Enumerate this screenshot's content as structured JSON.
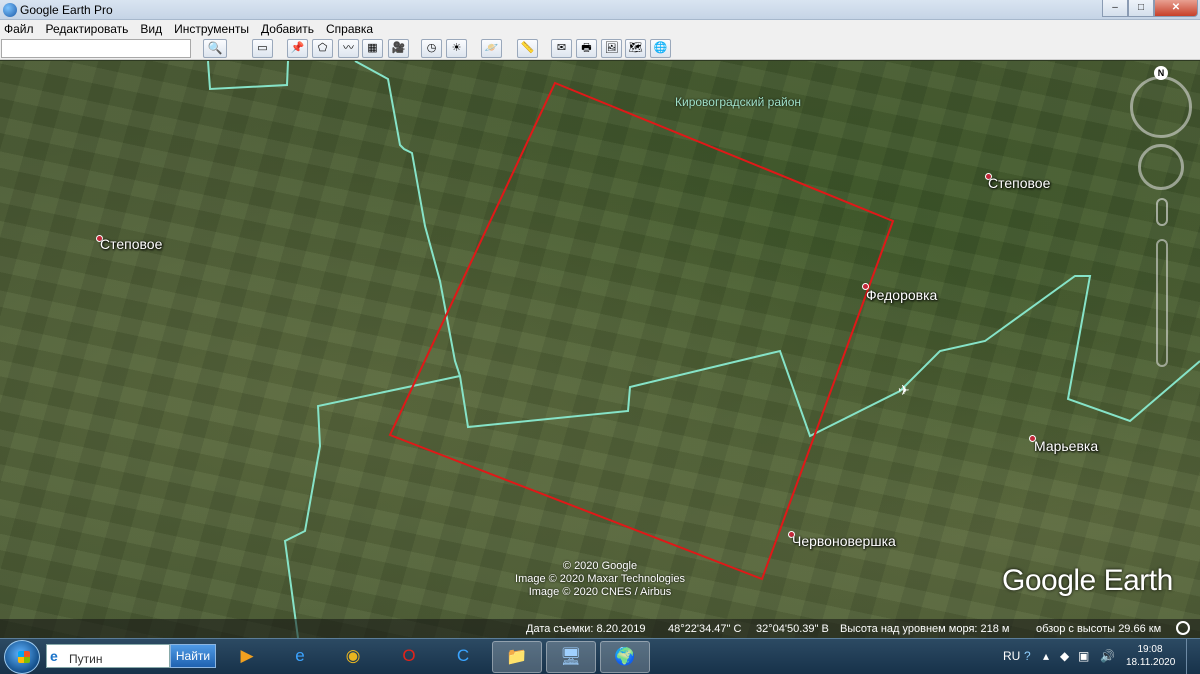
{
  "window": {
    "title": "Google Earth Pro",
    "controls": {
      "minimize": "–",
      "maximize": "□",
      "close": "✕"
    }
  },
  "menu": [
    "Файл",
    "Редактировать",
    "Вид",
    "Инструменты",
    "Добавить",
    "Справка"
  ],
  "search": {
    "value": "",
    "button_icon": "search-icon"
  },
  "toolbar": {
    "buttons": [
      {
        "name": "sidebar-icon",
        "glyph": "▭"
      },
      {
        "name": "add-placemark-icon",
        "glyph": "📌"
      },
      {
        "name": "add-polygon-icon",
        "glyph": "⬠"
      },
      {
        "name": "add-path-icon",
        "glyph": "〰"
      },
      {
        "name": "add-overlay-icon",
        "glyph": "▦"
      },
      {
        "name": "record-tour-icon",
        "glyph": "🎥"
      },
      {
        "name": "historical-imagery-icon",
        "glyph": "◷"
      },
      {
        "name": "sunlight-icon",
        "glyph": "☀"
      },
      {
        "name": "planets-icon",
        "glyph": "🪐"
      },
      {
        "name": "ruler-icon",
        "glyph": "📏"
      },
      {
        "name": "email-icon",
        "glyph": "✉"
      },
      {
        "name": "print-icon",
        "glyph": "🖶"
      },
      {
        "name": "save-image-icon",
        "glyph": "🖼"
      },
      {
        "name": "view-in-maps-icon",
        "glyph": "🗺"
      },
      {
        "name": "earth-icon",
        "glyph": "🌐"
      }
    ]
  },
  "map": {
    "region_label": "Кировоградский район",
    "places": [
      {
        "name": "Степовое"
      },
      {
        "name": "Степовое"
      },
      {
        "name": "Федоровка"
      },
      {
        "name": "Марьевка"
      },
      {
        "name": "Червоновершка"
      }
    ],
    "credits": [
      "© 2020 Google",
      "Image © 2020 Maxar Technologies",
      "Image © 2020 CNES / Airbus"
    ],
    "logo": "Google Earth",
    "compass_north": "N",
    "colors": {
      "polygon": "#e01818",
      "border": "#86e3c8",
      "place_dot": "#c3283a"
    }
  },
  "status": {
    "date": "Дата съемки: 8.20.2019",
    "lat": "48°22'34.47\" С",
    "lon": "32°04'50.39\" В",
    "elevation": "Высота над уровнем моря:  218 м",
    "eye_alt": "обзор с высоты  29.66 км"
  },
  "taskbar": {
    "search_value": "Путин",
    "search_button": "Найти",
    "apps": [
      {
        "name": "media-player-icon",
        "glyph": "▶",
        "color": "#f0a020"
      },
      {
        "name": "internet-explorer-icon",
        "glyph": "e",
        "color": "#3ba3ff"
      },
      {
        "name": "chrome-icon",
        "glyph": "◉",
        "color": "#e8b520"
      },
      {
        "name": "opera-icon",
        "glyph": "O",
        "color": "#e2231a"
      },
      {
        "name": "ccleaner-icon",
        "glyph": "C",
        "color": "#3aa4ff"
      },
      {
        "name": "file-explorer-icon",
        "glyph": "📁",
        "color": "#f2c84b"
      },
      {
        "name": "remote-desktop-icon",
        "glyph": "🖥",
        "color": "#9fd0ff"
      },
      {
        "name": "google-earth-pro-icon",
        "glyph": "🌍",
        "color": "#d8e4f0"
      }
    ],
    "tray": {
      "lang": "RU"
    },
    "clock": {
      "time": "19:08",
      "date": "18.11.2020"
    }
  }
}
